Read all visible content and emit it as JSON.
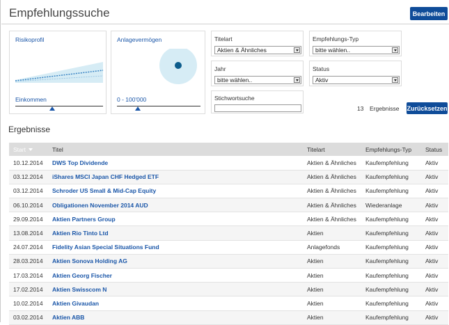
{
  "header": {
    "title": "Empfehlungssuche",
    "edit_button": "Bearbeiten"
  },
  "filters": {
    "risk": {
      "label": "Risikoprofil",
      "scale_label": "Einkommen"
    },
    "assets": {
      "label": "Anlagevermögen",
      "scale_label": "0 - 100'000"
    },
    "titelart": {
      "label": "Titelart",
      "value": "Aktien & Ähnliches"
    },
    "typ": {
      "label": "Empfehlungs-Typ",
      "value": "bitte wählen.."
    },
    "jahr": {
      "label": "Jahr",
      "value": "bitte wählen.."
    },
    "status": {
      "label": "Status",
      "value": "Aktiv"
    },
    "stichwort": {
      "label": "Stichwortsuche",
      "value": ""
    }
  },
  "results_bar": {
    "count": "13",
    "count_label": "Ergebnisse",
    "reset_button": "Zurücksetzen"
  },
  "results": {
    "heading": "Ergebnisse",
    "columns": [
      "Start",
      "Titel",
      "Titelart",
      "Empfehlungs-Typ",
      "Status"
    ],
    "rows": [
      [
        "10.12.2014",
        "DWS Top Dividende",
        "Aktien & Ähnliches",
        "Kaufempfehlung",
        "Aktiv"
      ],
      [
        "03.12.2014",
        "iShares MSCI Japan CHF Hedged ETF",
        "Aktien & Ähnliches",
        "Kaufempfehlung",
        "Aktiv"
      ],
      [
        "03.12.2014",
        "Schroder US Small & Mid-Cap Equity",
        "Aktien & Ähnliches",
        "Kaufempfehlung",
        "Aktiv"
      ],
      [
        "06.10.2014",
        "Obligationen November 2014 AUD",
        "Aktien & Ähnliches",
        "Wiederanlage",
        "Aktiv"
      ],
      [
        "29.09.2014",
        "Aktien Partners Group",
        "Aktien & Ähnliches",
        "Kaufempfehlung",
        "Aktiv"
      ],
      [
        "13.08.2014",
        "Aktien Rio Tinto Ltd",
        "Aktien",
        "Kaufempfehlung",
        "Aktiv"
      ],
      [
        "24.07.2014",
        "Fidelity Asian Special Situations Fund",
        "Anlagefonds",
        "Kaufempfehlung",
        "Aktiv"
      ],
      [
        "28.03.2014",
        "Aktien Sonova Holding AG",
        "Aktien",
        "Kaufempfehlung",
        "Aktiv"
      ],
      [
        "17.03.2014",
        "Aktien Georg Fischer",
        "Aktien",
        "Kaufempfehlung",
        "Aktiv"
      ],
      [
        "17.02.2014",
        "Aktien Swisscom N",
        "Aktien",
        "Kaufempfehlung",
        "Aktiv"
      ],
      [
        "10.02.2014",
        "Aktien Givaudan",
        "Aktien",
        "Kaufempfehlung",
        "Aktiv"
      ],
      [
        "03.02.2014",
        "Aktien ABB",
        "Aktien",
        "Kaufempfehlung",
        "Aktiv"
      ]
    ]
  },
  "colors": {
    "accent": "#0f4c99",
    "link": "#1a56a8",
    "chart_fill": "#d6ecf5",
    "dot": "#0d5c8c"
  }
}
